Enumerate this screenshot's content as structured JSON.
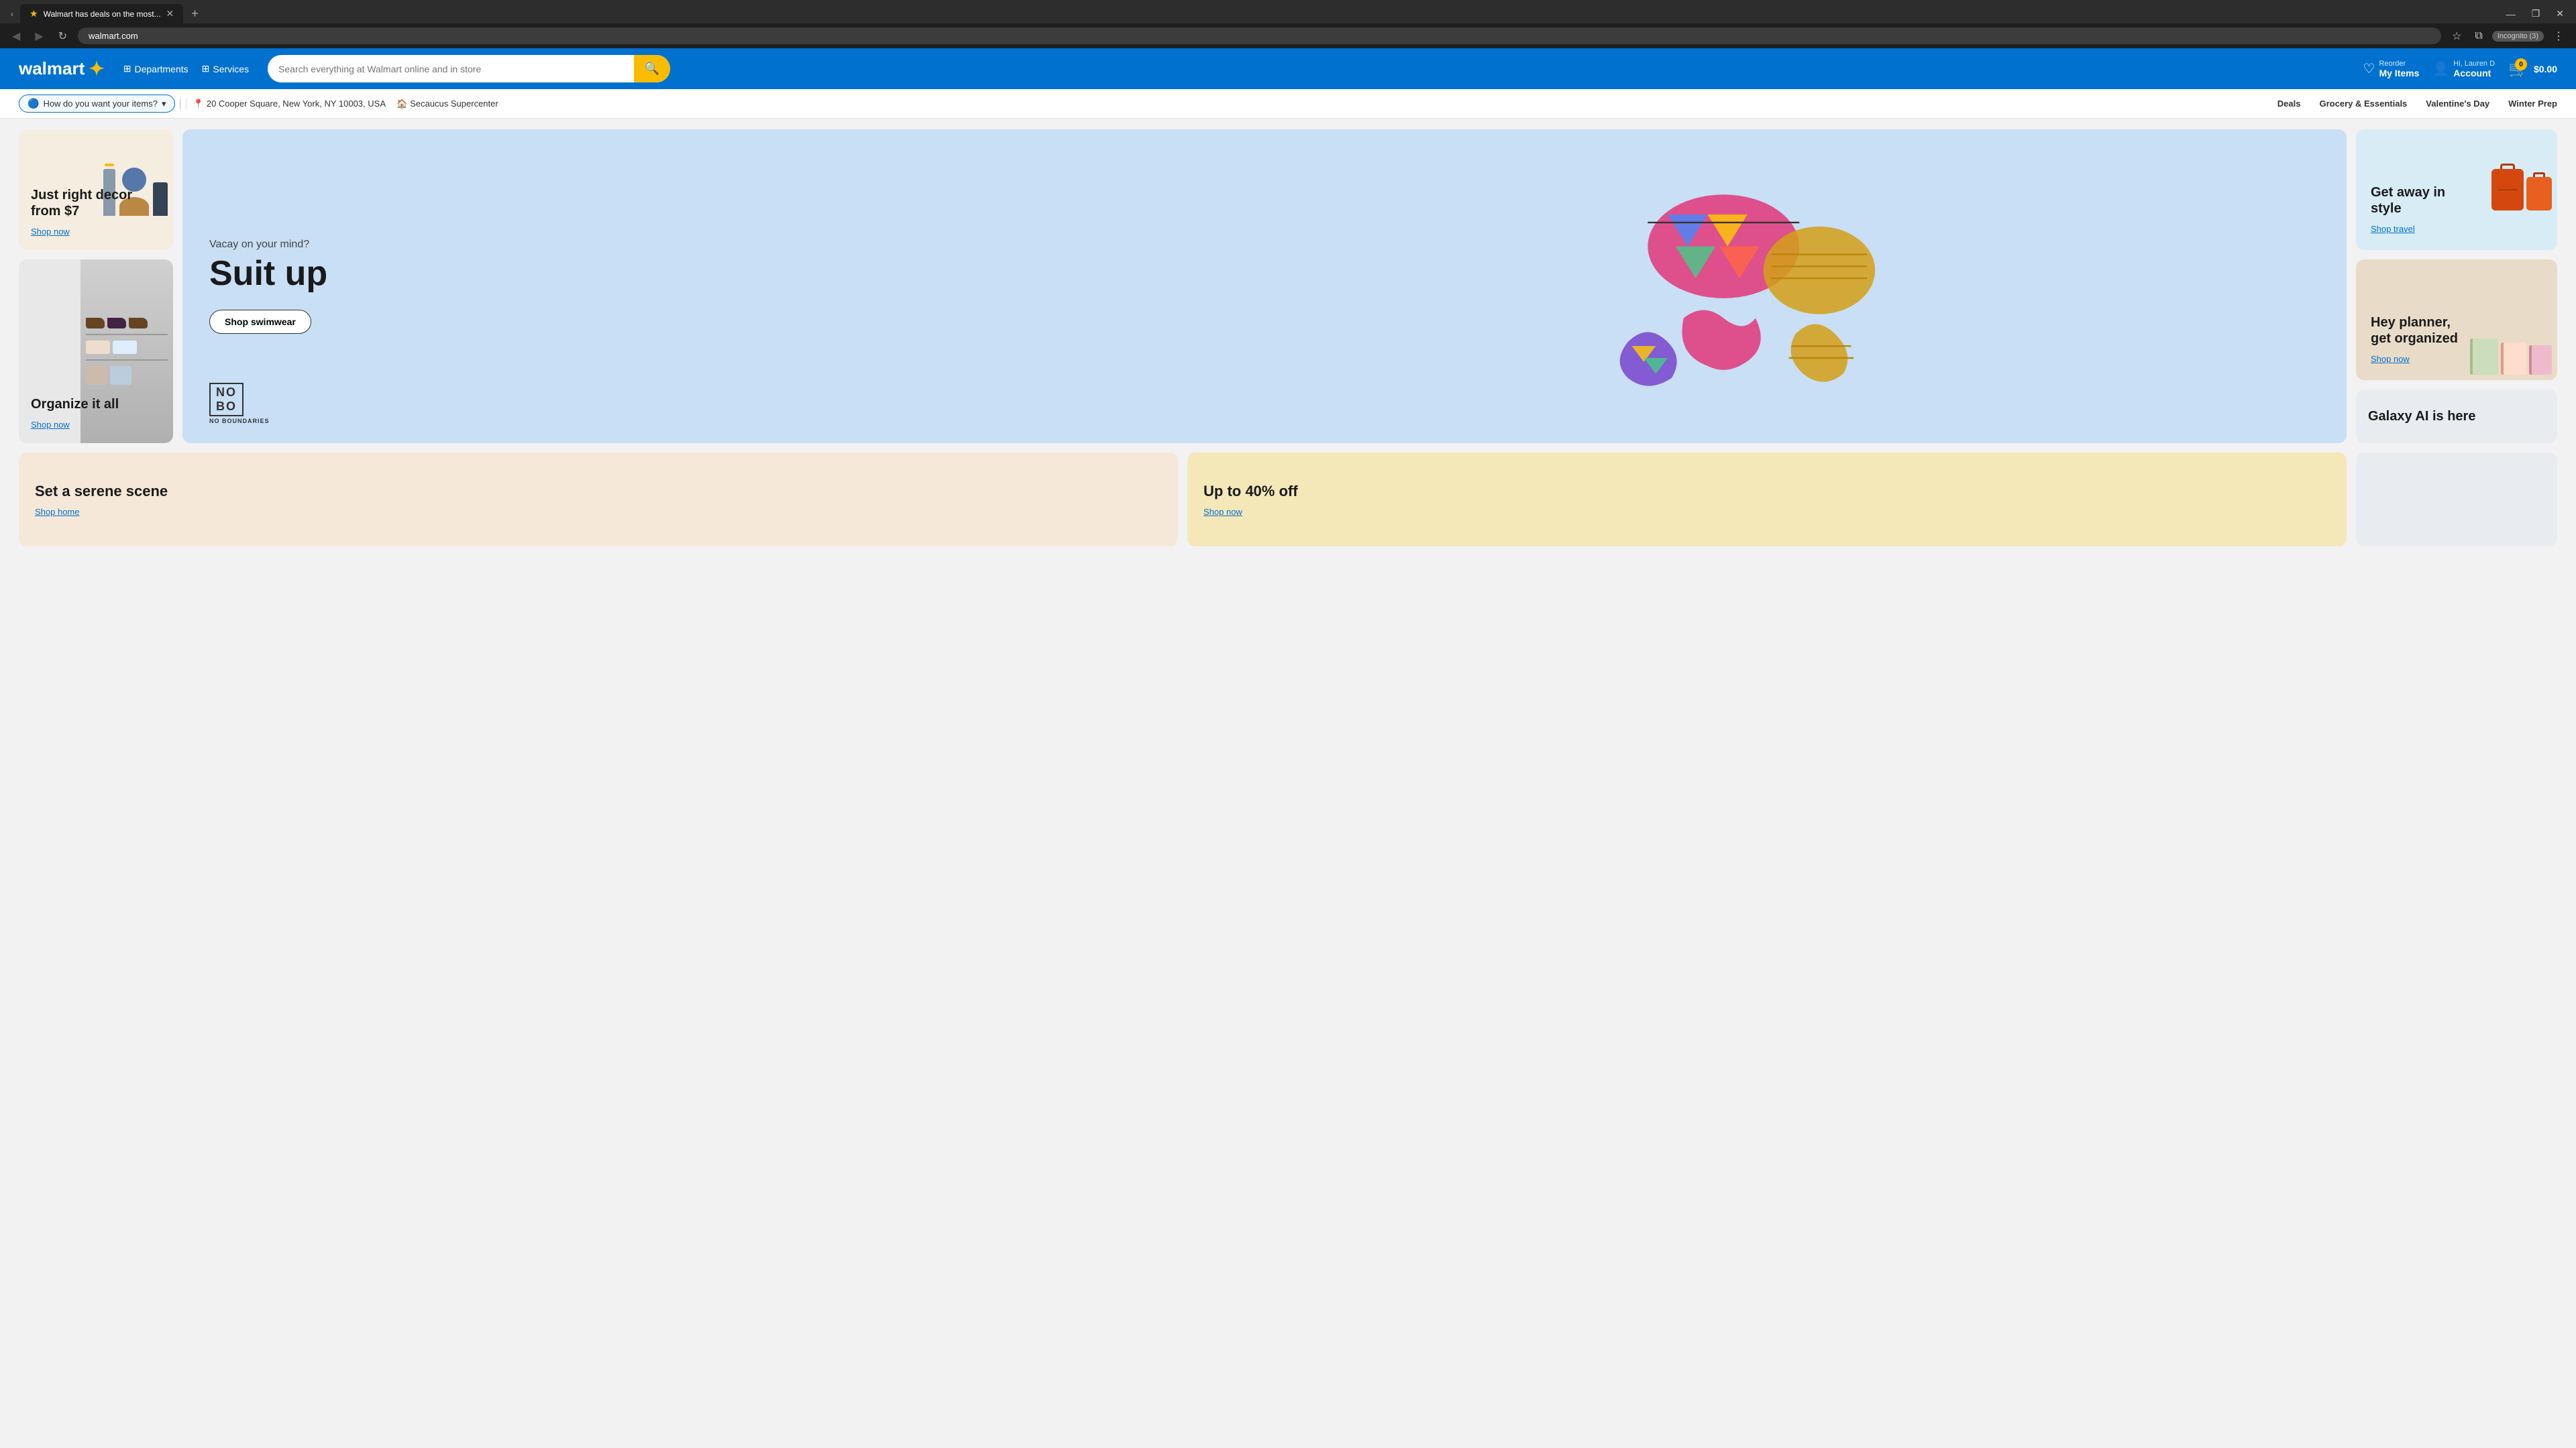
{
  "browser": {
    "tab": {
      "favicon": "★",
      "title": "Walmart has deals on the most...",
      "active": true
    },
    "url": "walmart.com",
    "incognito": "Incognito (3)",
    "window_controls": [
      "—",
      "❐",
      "✕"
    ]
  },
  "header": {
    "logo_text": "walmart",
    "spark": "✦",
    "departments_label": "Departments",
    "services_label": "Services",
    "search_placeholder": "Search everything at Walmart online and in store",
    "reorder_small": "Reorder",
    "reorder_large": "My Items",
    "account_small": "Hi, Lauren D",
    "account_large": "Account",
    "cart_count": "0",
    "cart_price": "$0.00"
  },
  "subnav": {
    "delivery_label": "How do you want your items?",
    "location": "20 Cooper Square, New York, NY 10003, USA",
    "store": "Secaucus Supercenter",
    "links": [
      {
        "label": "Deals"
      },
      {
        "label": "Grocery & Essentials"
      },
      {
        "label": "Valentine's Day"
      },
      {
        "label": "Winter Prep"
      }
    ]
  },
  "promos": {
    "decor": {
      "title": "Just right decor from $7",
      "link": "Shop now"
    },
    "organize": {
      "title": "Organize it all",
      "link": "Shop now"
    },
    "hero": {
      "subtitle": "Vacay on your mind?",
      "title": "Suit up",
      "btn": "Shop swimwear",
      "brand": "NO\nBO",
      "brand_sub": "NO BOUNDARIES"
    },
    "travel": {
      "title": "Get away in style",
      "link": "Shop travel"
    },
    "planner": {
      "title": "Hey planner, get organized",
      "link": "Shop now"
    },
    "galaxy": {
      "title": "Galaxy AI is here"
    },
    "serene": {
      "title": "Set a serene scene",
      "link": "Shop home"
    },
    "percent": {
      "title": "Up to 40% off",
      "link": "Shop now"
    }
  }
}
